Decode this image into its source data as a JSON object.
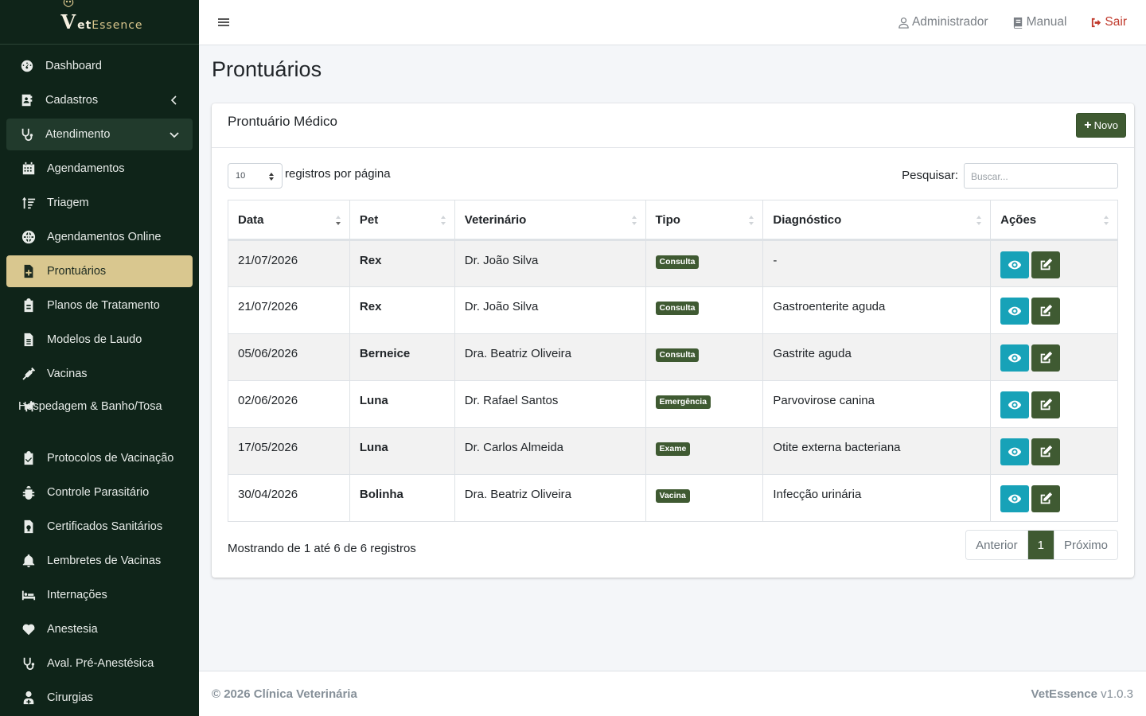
{
  "brand": {
    "v": "V",
    "et": "et",
    "essence": "Essence"
  },
  "sidebar": {
    "items": [
      {
        "label": "Dashboard",
        "icon": "tachometer-icon"
      },
      {
        "label": "Cadastros",
        "icon": "address-card-icon"
      },
      {
        "label": "Atendimento",
        "icon": "stethoscope-icon"
      },
      {
        "label": "Agendamentos",
        "icon": "calendar-icon"
      },
      {
        "label": "Triagem",
        "icon": "sort-amount-icon"
      },
      {
        "label": "Agendamentos Online",
        "icon": "globe-icon"
      },
      {
        "label": "Prontuários",
        "icon": "file-medical-icon"
      },
      {
        "label": "Planos de Tratamento",
        "icon": "clipboard-icon"
      },
      {
        "label": "Modelos de Laudo",
        "icon": "file-alt-icon"
      },
      {
        "label": "Vacinas",
        "icon": "syringe-icon"
      },
      {
        "label": "Hospedagem & Banho/Tosa",
        "icon": "dog-icon"
      },
      {
        "label": "Protocolos de Vacinação",
        "icon": "clipboard-check-icon"
      },
      {
        "label": "Controle Parasitário",
        "icon": "bug-icon"
      },
      {
        "label": "Certificados Sanitários",
        "icon": "file-certificate-icon"
      },
      {
        "label": "Lembretes de Vacinas",
        "icon": "bell-icon"
      },
      {
        "label": "Internações",
        "icon": "procedures-icon"
      },
      {
        "label": "Anestesia",
        "icon": "heartbeat-icon"
      },
      {
        "label": "Aval. Pré-Anestésica",
        "icon": "stethoscope-icon"
      },
      {
        "label": "Cirurgias",
        "icon": "user-md-icon"
      }
    ]
  },
  "topbar": {
    "admin": "Administrador",
    "manual": "Manual",
    "logout": "Sair"
  },
  "page": {
    "title": "Prontuários"
  },
  "card": {
    "title": "Prontuário Médico",
    "new_label": "Novo",
    "length_value": "10",
    "length_label": "registros por página",
    "search_label": "Pesquisar:",
    "search_placeholder": "Buscar..."
  },
  "table": {
    "headers": [
      "Data",
      "Pet",
      "Veterinário",
      "Tipo",
      "Diagnóstico",
      "Ações"
    ],
    "rows": [
      {
        "data": "21/07/2026",
        "pet": "Rex",
        "vet": "Dr. João Silva",
        "tipo": "Consulta",
        "diag": "-"
      },
      {
        "data": "21/07/2026",
        "pet": "Rex",
        "vet": "Dr. João Silva",
        "tipo": "Consulta",
        "diag": "Gastroenterite aguda"
      },
      {
        "data": "05/06/2026",
        "pet": "Berneice",
        "vet": "Dra. Beatriz Oliveira",
        "tipo": "Consulta",
        "diag": "Gastrite aguda"
      },
      {
        "data": "02/06/2026",
        "pet": "Luna",
        "vet": "Dr. Rafael Santos",
        "tipo": "Emergência",
        "diag": "Parvovirose canina"
      },
      {
        "data": "17/05/2026",
        "pet": "Luna",
        "vet": "Dr. Carlos Almeida",
        "tipo": "Exame",
        "diag": "Otite externa bacteriana"
      },
      {
        "data": "30/04/2026",
        "pet": "Bolinha",
        "vet": "Dra. Beatriz Oliveira",
        "tipo": "Vacina",
        "diag": "Infecção urinária"
      }
    ]
  },
  "info": "Mostrando de 1 até 6 de 6 registros",
  "pagination": {
    "prev": "Anterior",
    "page": "1",
    "next": "Próximo"
  },
  "footer": {
    "copy": "© 2026 Clínica Veterinária",
    "app": "VetEssence",
    "version": "v1.0.3"
  },
  "colors": {
    "sidebar_bg": "#0f2419",
    "active_bg": "#d9c78f",
    "primary_green": "#3f5a32",
    "view_blue": "#17a2b8",
    "logout_red": "#c0392b"
  }
}
